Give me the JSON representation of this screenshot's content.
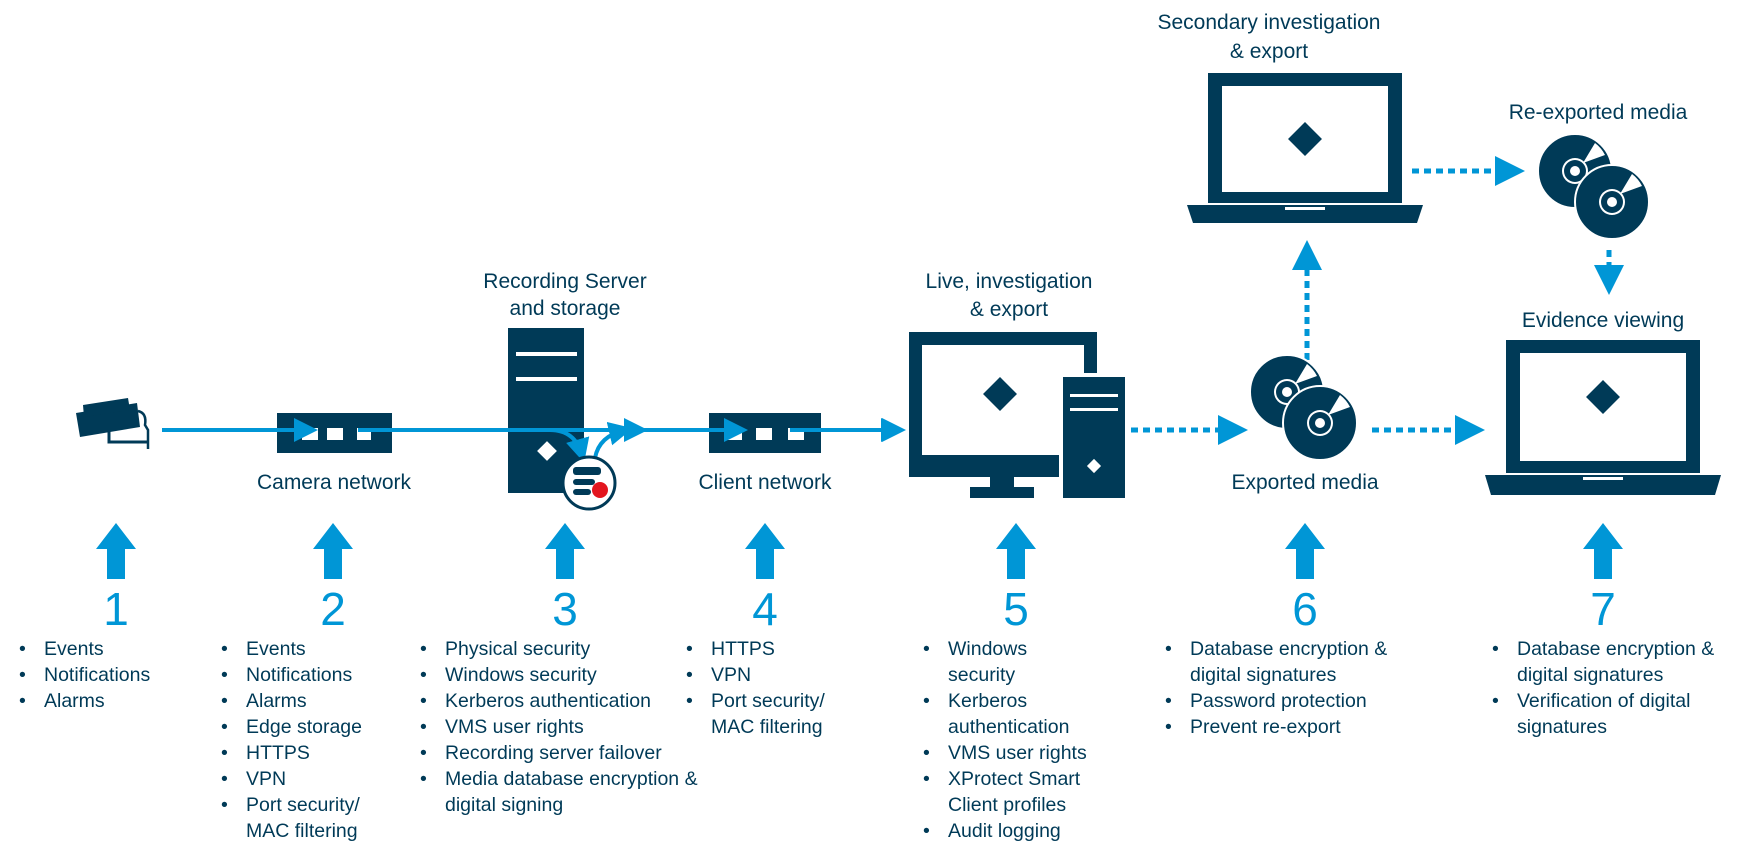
{
  "colors": {
    "navy": "#003a57",
    "accent": "#0096d6",
    "record": "#e3161f"
  },
  "labels": {
    "recording_server": [
      "Recording Server",
      "and storage"
    ],
    "camera_network": "Camera network",
    "client_network": "Client network",
    "live": [
      "Live, investigation",
      "& export"
    ],
    "exported_media": "Exported media",
    "secondary": [
      "Secondary investigation",
      "& export"
    ],
    "reexported_media": "Re-exported media",
    "evidence_viewing": "Evidence viewing"
  },
  "icons": [
    "camera-icon",
    "network-switch-icon",
    "server-icon",
    "database-record-icon",
    "desktop-computer-icon",
    "disc-media-icon",
    "laptop-icon",
    "up-arrow-icon"
  ],
  "steps": [
    {
      "number": "1",
      "items": [
        "Events",
        "Notifications",
        "Alarms"
      ]
    },
    {
      "number": "2",
      "items": [
        "Events",
        "Notifications",
        "Alarms",
        "Edge storage",
        "HTTPS",
        "VPN",
        "Port security/ MAC filtering"
      ]
    },
    {
      "number": "3",
      "items": [
        "Physical security",
        "Windows security",
        "Kerberos authentication",
        "VMS user rights",
        "Recording server failover",
        "Media database encryption & digital signing"
      ]
    },
    {
      "number": "4",
      "items": [
        "HTTPS",
        "VPN",
        "Port security/ MAC filtering"
      ]
    },
    {
      "number": "5",
      "items": [
        "Windows security",
        "Kerberos authentication",
        "VMS user rights",
        "XProtect Smart Client profiles",
        "Audit logging"
      ]
    },
    {
      "number": "6",
      "items": [
        "Database encryption & digital signatures",
        "Password protection",
        "Prevent re-export"
      ]
    },
    {
      "number": "7",
      "items": [
        "Database encryption & digital signatures",
        "Verification of digital signatures"
      ]
    }
  ]
}
